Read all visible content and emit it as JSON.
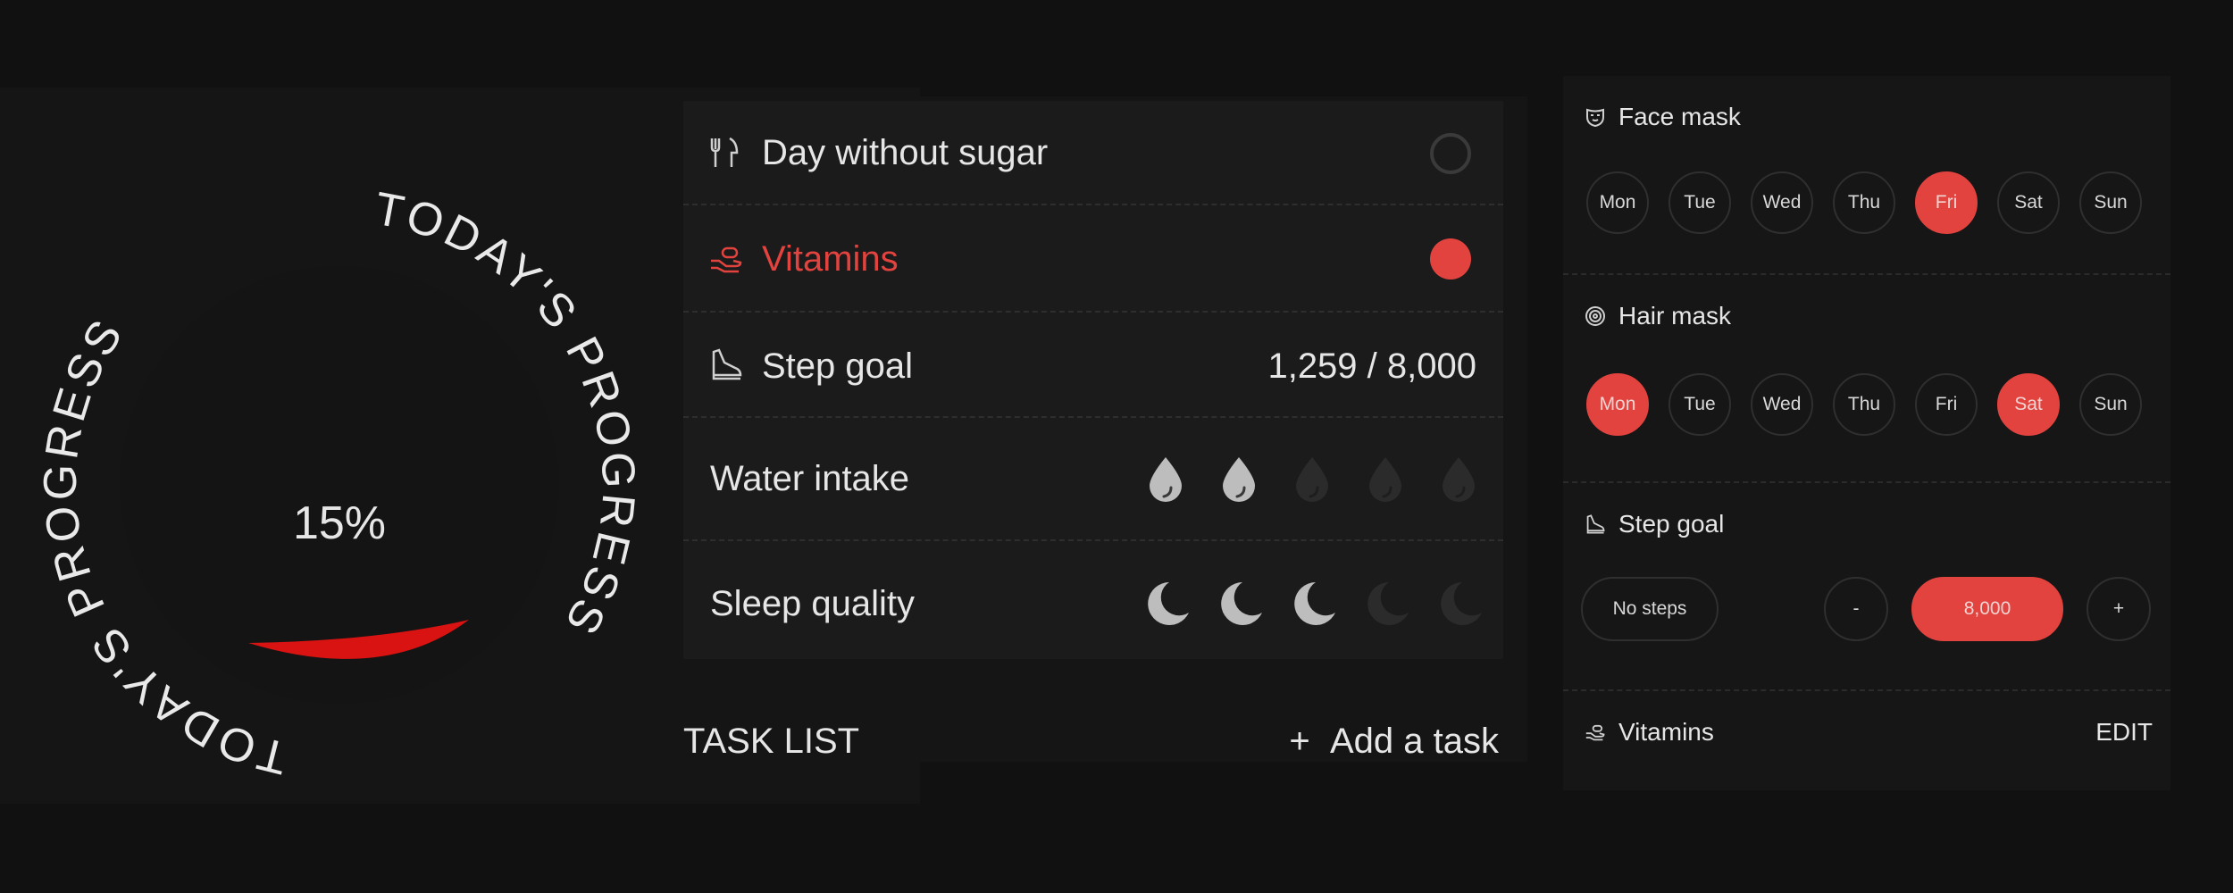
{
  "progress": {
    "ring_text": "TODAY'S PROGRESS",
    "percent_label": "15%",
    "percent_value": 15,
    "accent": "#e01b1b"
  },
  "tasks": {
    "items": [
      {
        "icon": "fork-knife-icon",
        "label": "Day without sugar",
        "checked": false
      },
      {
        "icon": "pill-hand-icon",
        "label": "Vitamins",
        "checked": true
      },
      {
        "icon": "shoe-icon",
        "label": "Step goal",
        "value": "1,259 / 8,000"
      },
      {
        "label": "Water intake",
        "icon": "water-drop-icon",
        "filled": 2,
        "total": 5
      },
      {
        "label": "Sleep quality",
        "icon": "moon-icon",
        "filled": 3,
        "total": 5
      }
    ],
    "list_title": "TASK LIST",
    "add_label": "Add a task",
    "add_symbol": "+"
  },
  "schedule": {
    "face_mask": {
      "title": "Face mask",
      "icon": "mask-icon",
      "days": [
        "Mon",
        "Tue",
        "Wed",
        "Thu",
        "Fri",
        "Sat",
        "Sun"
      ],
      "selected": [
        "Fri"
      ]
    },
    "hair_mask": {
      "title": "Hair mask",
      "icon": "spiral-icon",
      "days": [
        "Mon",
        "Tue",
        "Wed",
        "Thu",
        "Fri",
        "Sat",
        "Sun"
      ],
      "selected": [
        "Mon",
        "Sat"
      ]
    },
    "step_goal": {
      "title": "Step goal",
      "icon": "shoe-icon",
      "no_steps": "No steps",
      "minus": "-",
      "value": "8,000",
      "plus": "+"
    },
    "vitamins": {
      "title": "Vitamins",
      "icon": "pill-hand-icon",
      "edit": "EDIT"
    }
  },
  "colors": {
    "accent": "#e2433f",
    "background": "#111111",
    "panel": "#1b1b1b"
  }
}
